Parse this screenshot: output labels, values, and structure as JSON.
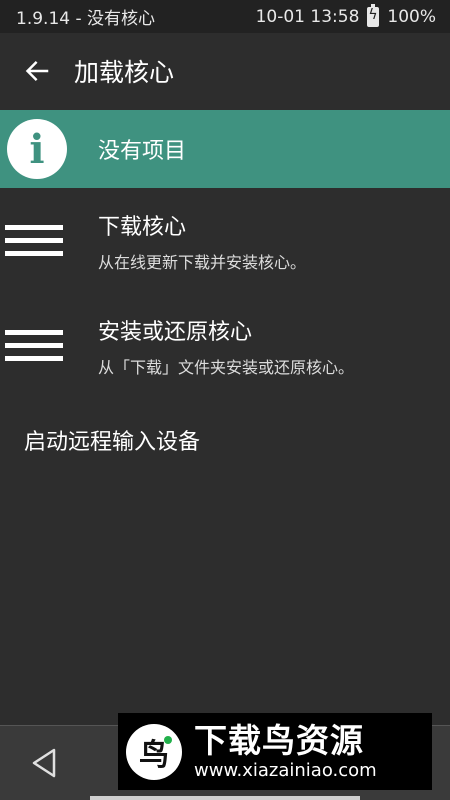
{
  "status_bar": {
    "left": "1.9.14 - 没有核心",
    "datetime": "10-01 13:58",
    "battery": "100%"
  },
  "app_bar": {
    "title": "加载核心"
  },
  "list": {
    "highlighted": {
      "label": "没有项目",
      "icon": "info-icon"
    },
    "items": [
      {
        "title": "下载核心",
        "subtitle": "从在线更新下载并安装核心。",
        "icon": "menu-icon"
      },
      {
        "title": "安装或还原核心",
        "subtitle": "从「下载」文件夹安装或还原核心。",
        "icon": "menu-icon"
      }
    ],
    "plain_item": {
      "label": "启动远程输入设备"
    }
  },
  "watermark": {
    "logo": "鸟",
    "title": "下载鸟资源",
    "url": "www.xiazainiao.com"
  },
  "colors": {
    "background": "#2d2d2d",
    "status_bar": "#222222",
    "highlight": "#3f9280",
    "nav_bar": "#3a3a3a"
  }
}
